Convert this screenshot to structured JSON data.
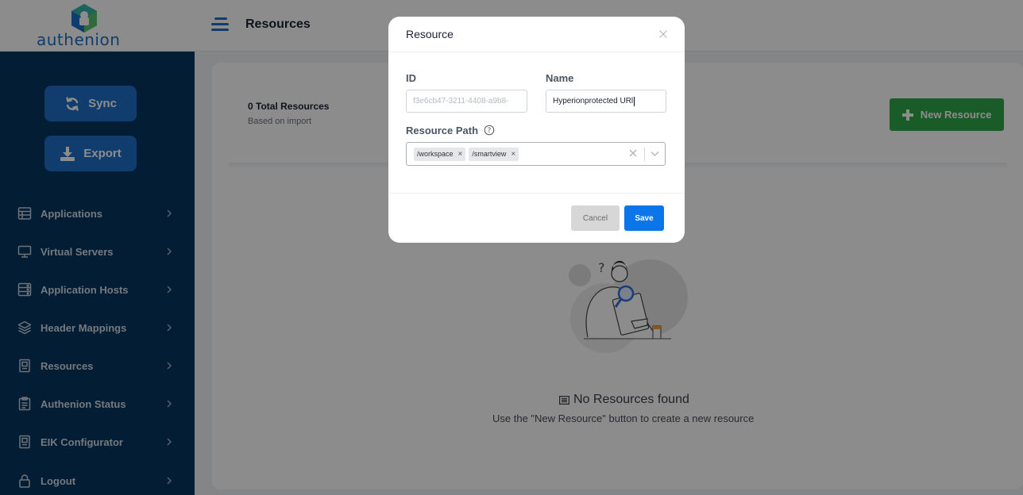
{
  "brand": {
    "name": "authenion"
  },
  "header": {
    "title": "Resources"
  },
  "sidebar": {
    "sync_label": "Sync",
    "export_label": "Export",
    "items": [
      {
        "label": "Applications",
        "icon": "applications-icon"
      },
      {
        "label": "Virtual Servers",
        "icon": "monitor-icon"
      },
      {
        "label": "Application Hosts",
        "icon": "server-icon"
      },
      {
        "label": "Header Mappings",
        "icon": "layers-icon"
      },
      {
        "label": "Resources",
        "icon": "resource-icon"
      },
      {
        "label": "Authenion Status",
        "icon": "status-icon"
      },
      {
        "label": "EIK Configurator",
        "icon": "config-icon"
      },
      {
        "label": "Logout",
        "icon": "lock-icon"
      }
    ]
  },
  "main": {
    "total": "0 Total Resources",
    "subtitle": "Based on import",
    "new_button": "New Resource",
    "empty_title": "No Resources found",
    "empty_subtitle": "Use the \"New Resource\" button to create a new resource"
  },
  "modal": {
    "title": "Resource",
    "id_label": "ID",
    "id_value": "f3e6cb47-3211-4408-a9b8-",
    "name_label": "Name",
    "name_value": "Hyperionprotected URl",
    "path_label": "Resource Path",
    "paths": [
      "/workspace",
      "/smartview"
    ],
    "cancel_label": "Cancel",
    "save_label": "Save"
  },
  "colors": {
    "sidebar": "#07355f",
    "primary": "#1e6fc9",
    "success": "#2ea84a",
    "save": "#0b76ea"
  }
}
